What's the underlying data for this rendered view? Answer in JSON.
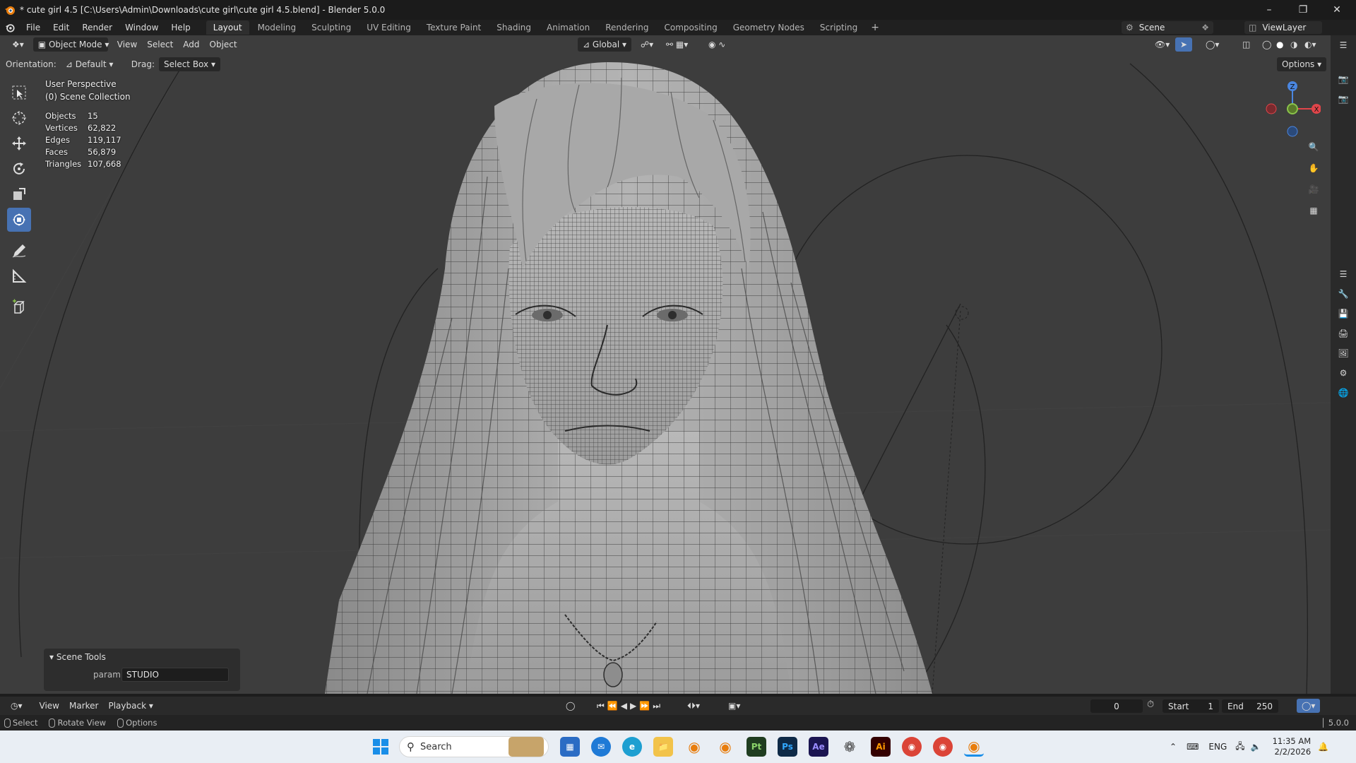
{
  "window": {
    "title": "* cute girl 4.5 [C:\\Users\\Admin\\Downloads\\cute girl\\cute girl 4.5.blend] - Blender 5.0.0"
  },
  "menu": [
    "File",
    "Edit",
    "Render",
    "Window",
    "Help"
  ],
  "workspaces": [
    {
      "label": "Layout",
      "active": true
    },
    {
      "label": "Modeling"
    },
    {
      "label": "Sculpting"
    },
    {
      "label": "UV Editing"
    },
    {
      "label": "Texture Paint"
    },
    {
      "label": "Shading"
    },
    {
      "label": "Animation"
    },
    {
      "label": "Rendering"
    },
    {
      "label": "Compositing"
    },
    {
      "label": "Geometry Nodes"
    },
    {
      "label": "Scripting"
    }
  ],
  "add_workspace": "+",
  "scene_name": "Scene",
  "view_layer": "ViewLayer",
  "viewport_header": {
    "mode": "Object Mode",
    "menus": [
      "View",
      "Select",
      "Add",
      "Object"
    ],
    "transform_orientation": "Global",
    "options_label": "Options"
  },
  "tool_settings": {
    "orientation_label": "Orientation:",
    "orientation_value": "Default",
    "drag_label": "Drag:",
    "drag_value": "Select Box"
  },
  "overlay": {
    "perspective": "User Perspective",
    "collection": "(0) Scene Collection",
    "stats": [
      {
        "label": "Objects",
        "value": "15"
      },
      {
        "label": "Vertices",
        "value": "62,822"
      },
      {
        "label": "Edges",
        "value": "119,117"
      },
      {
        "label": "Faces",
        "value": "56,879"
      },
      {
        "label": "Triangles",
        "value": "107,668"
      }
    ]
  },
  "gizmo": {
    "z": "Z",
    "x": "X"
  },
  "redo_panel": {
    "title": "Scene Tools",
    "param_label": "param",
    "param_value": "STUDIO"
  },
  "timeline": {
    "menus": [
      "View",
      "Marker",
      "Playback"
    ],
    "current_frame": "0",
    "start_label": "Start",
    "start_value": "1",
    "end_label": "End",
    "end_value": "250"
  },
  "statusbar": {
    "select": "Select",
    "rotate": "Rotate View",
    "options": "Options",
    "version": "5.0.0"
  },
  "taskbar": {
    "search_placeholder": "Search",
    "apps": [
      "Pt",
      "Ps",
      "Ae",
      "Ai"
    ],
    "language": "ENG",
    "time": "11:35 AM",
    "date": "2/2/2026"
  },
  "colors": {
    "accent": "#4772b3",
    "viewport_bg": "#3d3d3d",
    "axis_x": "#e0454a",
    "axis_y": "#8ac34a",
    "axis_z": "#4a86e0"
  }
}
